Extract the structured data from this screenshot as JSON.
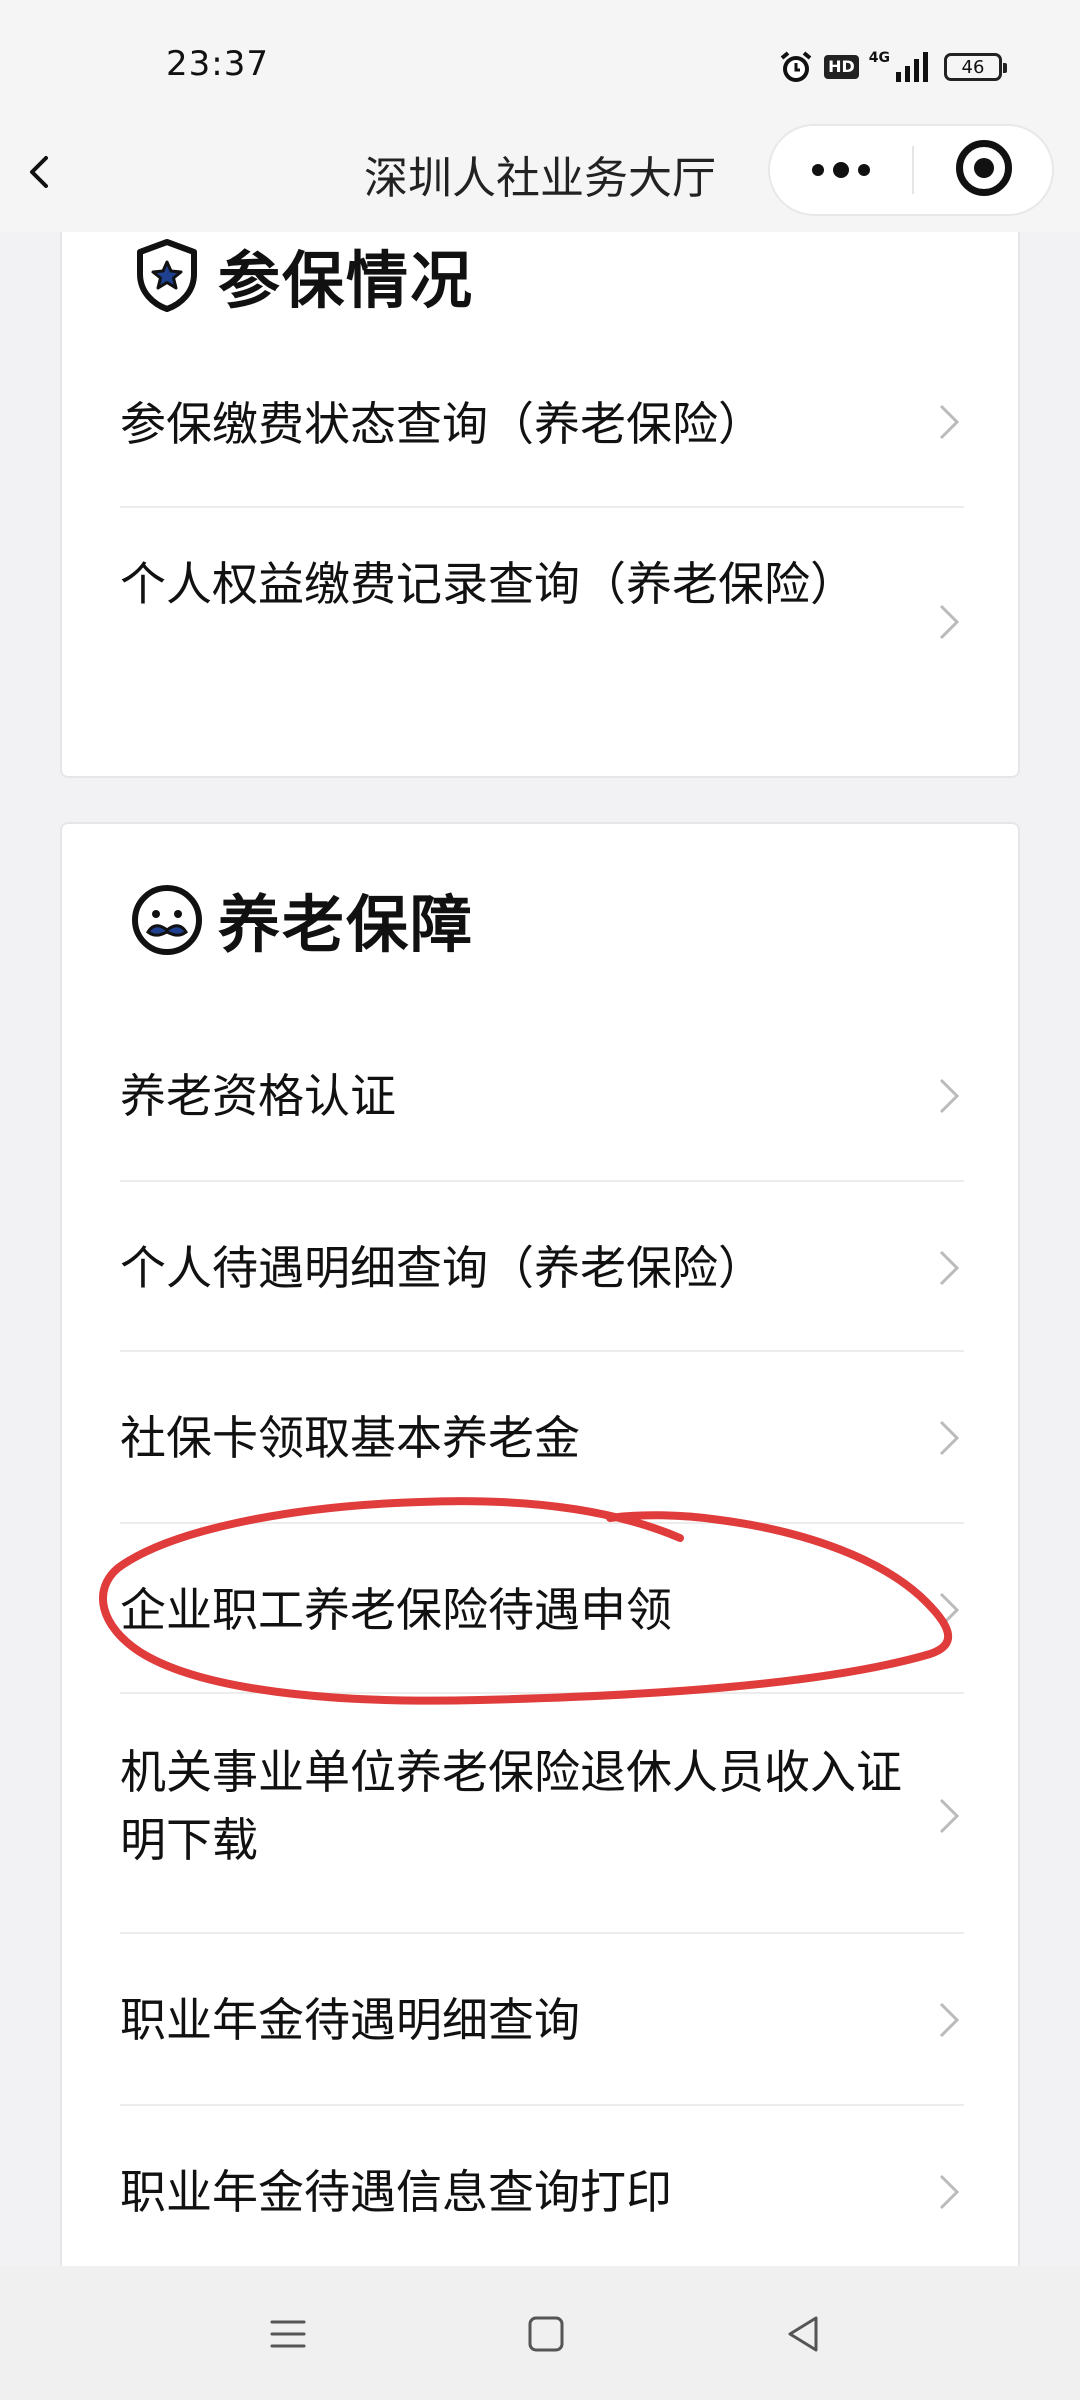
{
  "status_bar": {
    "time": "23:37",
    "hd": "HD",
    "network": "4G",
    "battery": "46"
  },
  "header": {
    "title": "深圳人社业务大厅"
  },
  "sections": [
    {
      "title": "参保情况",
      "icon": "shield-star-icon",
      "items": [
        {
          "label": "参保缴费状态查询（养老保险）"
        },
        {
          "label": "个人权益缴费记录查询（养老保险）"
        }
      ]
    },
    {
      "title": "养老保障",
      "icon": "elder-face-icon",
      "items": [
        {
          "label": "养老资格认证"
        },
        {
          "label": "个人待遇明细查询（养老保险）"
        },
        {
          "label": "社保卡领取基本养老金"
        },
        {
          "label": "企业职工养老保险待遇申领",
          "highlighted": true
        },
        {
          "label": "机关事业单位养老保险退休人员收入证明下载"
        },
        {
          "label": "职业年金待遇明细查询"
        },
        {
          "label": "职业年金待遇信息查询打印"
        }
      ]
    }
  ],
  "annotation_color": "#e03c3c"
}
